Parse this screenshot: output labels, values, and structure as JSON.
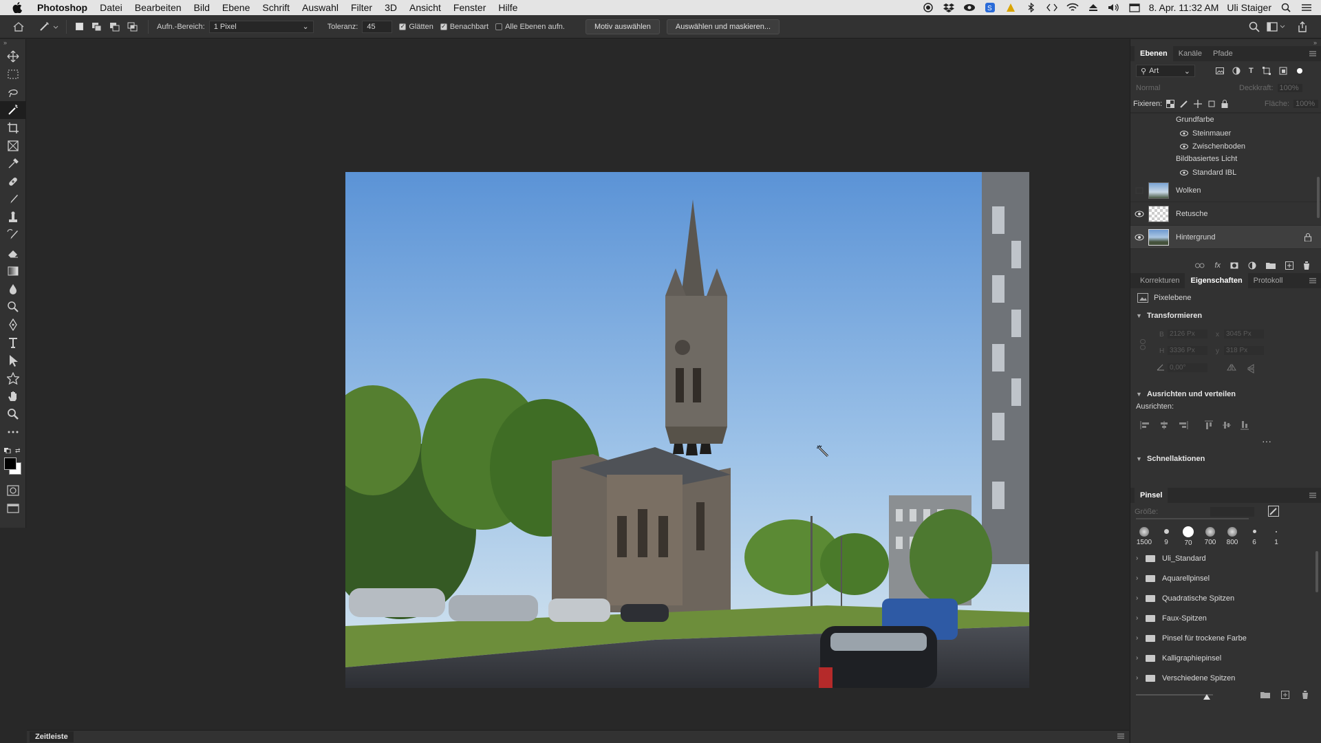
{
  "menubar": {
    "app_name": "Photoshop",
    "items": [
      "Datei",
      "Bearbeiten",
      "Bild",
      "Ebene",
      "Schrift",
      "Auswahl",
      "Filter",
      "3D",
      "Ansicht",
      "Fenster",
      "Hilfe"
    ],
    "clock": "8. Apr. 11:32 AM",
    "user": "Uli Staiger"
  },
  "options": {
    "sample_label": "Aufn.-Bereich:",
    "sample_value": "1 Pixel",
    "tolerance_label": "Toleranz:",
    "tolerance_value": "45",
    "antialias_label": "Glätten",
    "contiguous_label": "Benachbart",
    "all_layers_label": "Alle Ebenen aufn.",
    "select_subject_label": "Motiv auswählen",
    "select_mask_label": "Auswählen und maskieren..."
  },
  "layers_panel": {
    "tabs": [
      "Ebenen",
      "Kanäle",
      "Pfade"
    ],
    "filter_value": "Art",
    "blend_mode": "Normal",
    "opacity_label": "Deckkraft:",
    "opacity_value": "100%",
    "lock_label": "Fixieren:",
    "fill_label": "Fläche:",
    "fill_value": "100%",
    "effects": {
      "grundfarbe": "Grundfarbe",
      "steinmauer": "Steinmauer",
      "zwischenboden": "Zwischenboden",
      "ibl": "Bildbasiertes Licht",
      "standard_ibl": "Standard IBL"
    },
    "layers": [
      {
        "name": "Wolken",
        "visible": false
      },
      {
        "name": "Retusche",
        "visible": true
      },
      {
        "name": "Hintergrund",
        "visible": true,
        "locked": true,
        "selected": true
      }
    ]
  },
  "properties_panel": {
    "tabs": [
      "Korrekturen",
      "Eigenschaften",
      "Protokoll"
    ],
    "type_label": "Pixelebene",
    "transform_title": "Transformieren",
    "w_label": "B",
    "w_value": "2126 Px",
    "x_label": "x",
    "x_value": "3045 Px",
    "h_label": "H",
    "h_value": "3336 Px",
    "y_label": "y",
    "y_value": "318 Px",
    "angle_value": "0,00°",
    "align_title": "Ausrichten und verteilen",
    "align_label": "Ausrichten:",
    "quick_title": "Schnellaktionen"
  },
  "brush_panel": {
    "title": "Pinsel",
    "size_label": "Größe:",
    "presets": [
      "1500",
      "9",
      "70",
      "700",
      "800",
      "6",
      "1"
    ],
    "folders": [
      "Uli_Standard",
      "Aquarellpinsel",
      "Quadratische Spitzen",
      "Faux-Spitzen",
      "Pinsel für trockene Farbe",
      "Kalligraphiepinsel",
      "Verschiedene Spitzen"
    ]
  },
  "statusbar": {
    "timeline_label": "Zeitleiste"
  },
  "tools": [
    "move-tool",
    "marquee-tool",
    "lasso-tool",
    "magic-wand-tool",
    "crop-tool",
    "frame-tool",
    "eyedropper-tool",
    "healing-brush-tool",
    "brush-tool",
    "clone-stamp-tool",
    "history-brush-tool",
    "eraser-tool",
    "gradient-tool",
    "blur-tool",
    "dodge-tool",
    "pen-tool",
    "type-tool",
    "path-selection-tool",
    "shape-tool",
    "hand-tool",
    "zoom-tool",
    "more-tools"
  ],
  "active_tool": "magic-wand-tool",
  "colors": {
    "foreground": "#000000",
    "background": "#ffffff",
    "panel": "#323232",
    "workspace": "#282828"
  }
}
